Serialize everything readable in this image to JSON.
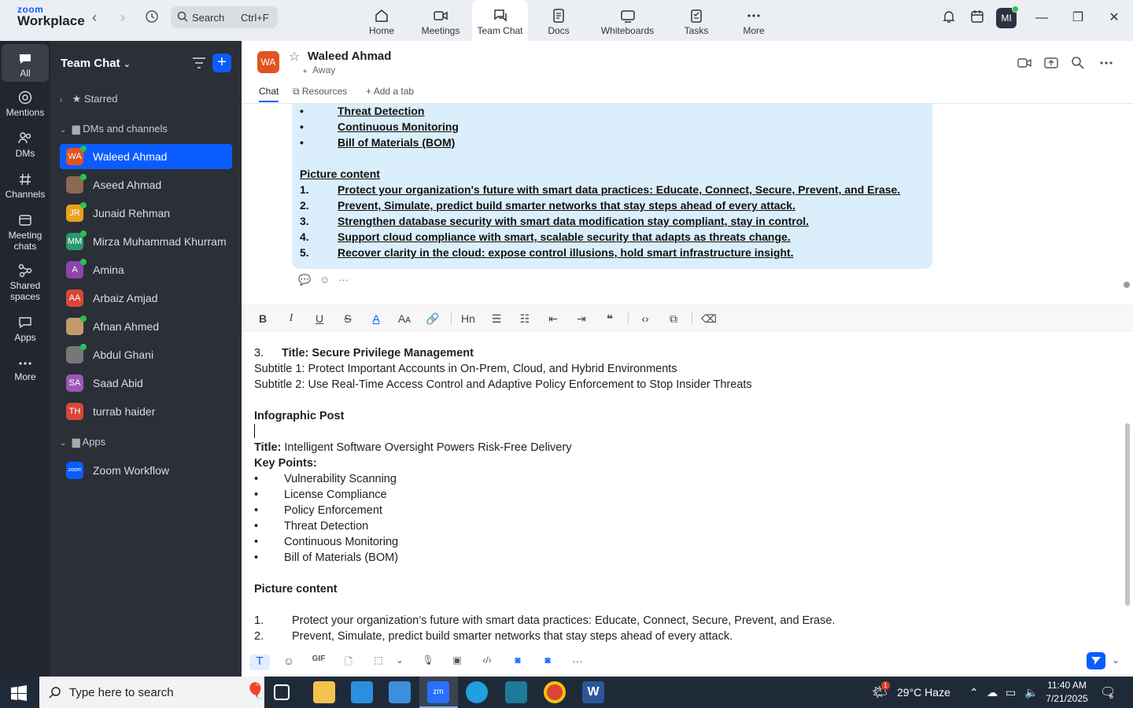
{
  "app": {
    "logo_line1": "zoom",
    "logo_line2": "Workplace"
  },
  "search": {
    "label": "Search",
    "shortcut": "Ctrl+F"
  },
  "nav_tabs": [
    {
      "label": "Home",
      "icon": "home-icon"
    },
    {
      "label": "Meetings",
      "icon": "video-icon"
    },
    {
      "label": "Team Chat",
      "icon": "chat-icon"
    },
    {
      "label": "Docs",
      "icon": "docs-icon"
    },
    {
      "label": "Whiteboards",
      "icon": "whiteboard-icon"
    },
    {
      "label": "Tasks",
      "icon": "tasks-icon"
    },
    {
      "label": "More",
      "icon": "more-icon"
    }
  ],
  "me": {
    "initials": "MI"
  },
  "rail": [
    {
      "label": "All"
    },
    {
      "label": "Mentions"
    },
    {
      "label": "DMs"
    },
    {
      "label": "Channels"
    },
    {
      "label": "Meeting chats"
    },
    {
      "label": "Shared spaces"
    },
    {
      "label": "Apps"
    },
    {
      "label": "More"
    }
  ],
  "sidepanel": {
    "title": "Team Chat",
    "starred": "Starred",
    "dms_section": "DMs and channels",
    "apps_section": "Apps",
    "contacts": [
      {
        "initials": "WA",
        "name": "Waleed Ahmad",
        "color": "#e2531f"
      },
      {
        "initials": "",
        "name": "Aseed Ahmad",
        "color": "#8a6a52"
      },
      {
        "initials": "JR",
        "name": "Junaid Rehman",
        "color": "#e8a21c"
      },
      {
        "initials": "MM",
        "name": "Mirza Muhammad Khurram",
        "color": "#2a9a6a"
      },
      {
        "initials": "A",
        "name": "Amina",
        "color": "#8e44ad"
      },
      {
        "initials": "AA",
        "name": "Arbaiz Amjad",
        "color": "#d9473a"
      },
      {
        "initials": "",
        "name": "Afnan Ahmed",
        "color": "#c49a6c"
      },
      {
        "initials": "",
        "name": "Abdul Ghani",
        "color": "#777777"
      },
      {
        "initials": "SA",
        "name": "Saad Abid",
        "color": "#9b59b6"
      },
      {
        "initials": "TH",
        "name": "turrab haider",
        "color": "#d9473a"
      }
    ],
    "apps": [
      {
        "initials": "zoom",
        "name": "Zoom Workflow",
        "color": "#0b5cff"
      }
    ]
  },
  "chat": {
    "avatar": "WA",
    "name": "Waleed Ahmad",
    "status": "Away",
    "tabs": [
      "Chat",
      "Resources",
      "Add a tab"
    ]
  },
  "message": {
    "bullets": [
      "Threat Detection",
      "Continuous Monitoring",
      "Bill of Materials (BOM)"
    ],
    "bullet_char": "•",
    "picture_heading": "Picture content",
    "picture_items": [
      "Protect your organization's future with smart data practices: Educate, Connect, Secure, Prevent, and Erase.",
      "Prevent, Simulate, predict build smarter networks that stay steps ahead of every attack.",
      "Strengthen database security with smart data modification stay compliant, stay in control.",
      "Support cloud compliance with smart, scalable security that adapts as threats change.",
      "Recover clarity in the cloud: expose control illusions, hold smart infrastructure insight."
    ],
    "picture_nums": [
      "1.",
      "2.",
      "3.",
      "4.",
      "5."
    ]
  },
  "editor": {
    "item3_num": "3.",
    "item3_title": "Title: Secure Privilege Management",
    "subtitle1": "Subtitle 1: Protect Important Accounts in On-Prem, Cloud, and Hybrid Environments",
    "subtitle2": "Subtitle 2:  Use Real-Time Access Control and Adaptive Policy Enforcement to Stop Insider Threats",
    "infographic": "Infographic Post",
    "title_label": "Title:",
    "title_value": "Intelligent Software Oversight Powers Risk-Free Delivery",
    "key_points": "Key Points:",
    "points": [
      "Vulnerability Scanning",
      "License Compliance",
      "Policy Enforcement",
      "Threat Detection",
      "Continuous Monitoring",
      "Bill of Materials (BOM)"
    ],
    "picture_heading": "Picture content",
    "items": [
      "Protect your organization’s future with smart data practices: Educate, Connect, Secure, Prevent, and Erase.",
      "Prevent, Simulate, predict build smarter networks that stay steps ahead of every attack."
    ],
    "item_nums": [
      "1.",
      "2."
    ]
  },
  "taskbar": {
    "search_placeholder": "Type here to search",
    "weather": "29°C  Haze",
    "time": "11:40 AM",
    "date": "7/21/2025",
    "notif_count": "5",
    "weather_badge": "1"
  }
}
